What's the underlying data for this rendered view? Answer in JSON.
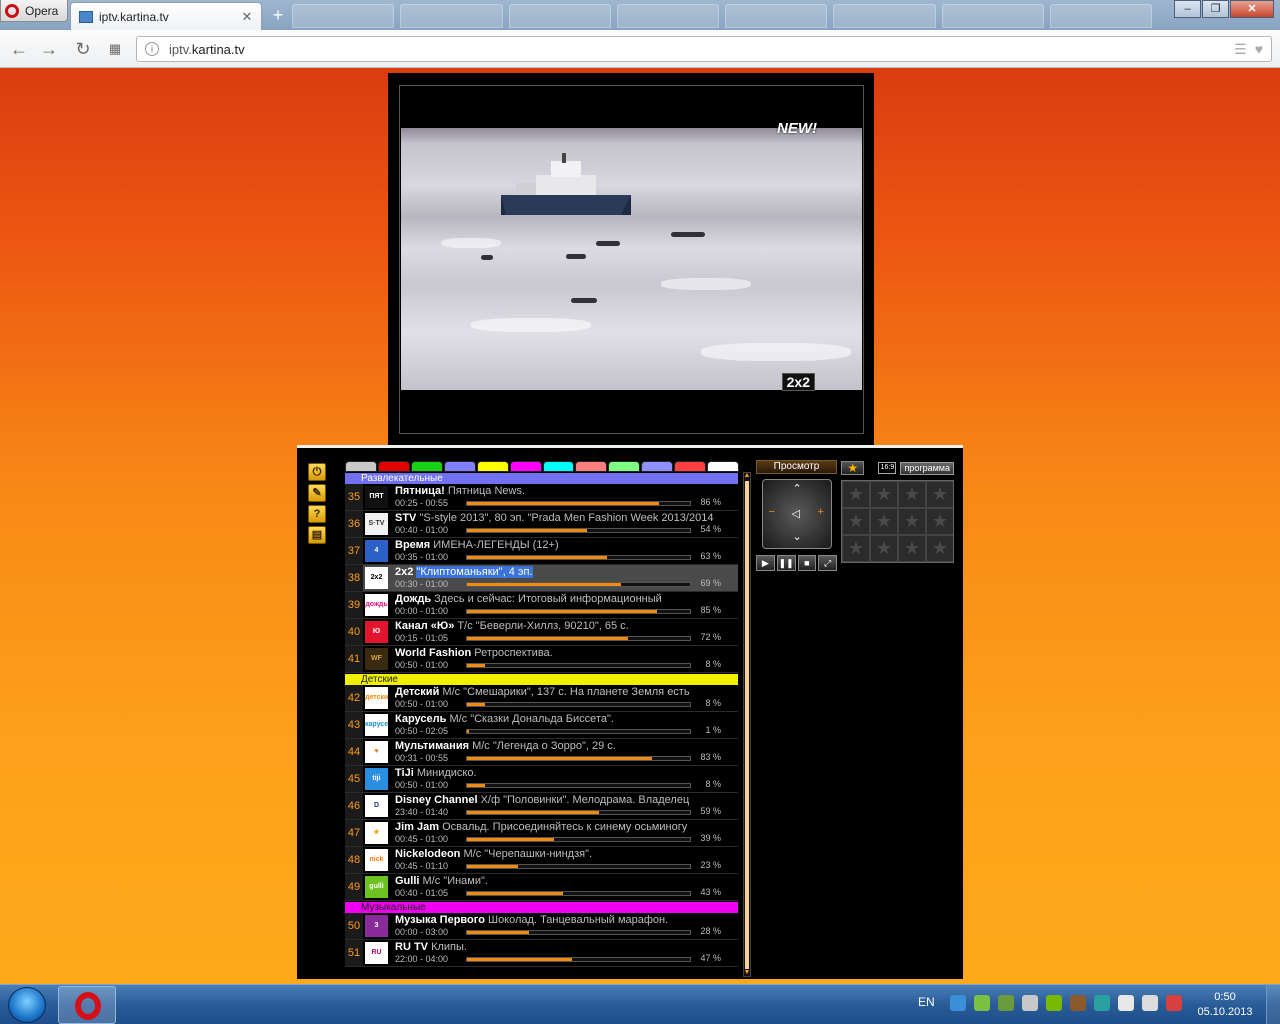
{
  "browser": {
    "menu_label": "Opera",
    "tab_title": "iptv.kartina.tv",
    "url": "iptv.kartina.tv",
    "url_host": "kartina.tv",
    "url_prefix": "iptv."
  },
  "player": {
    "badge_new": "NEW!",
    "channel_logo": "2x2"
  },
  "groups": [
    "#c9c9c9",
    "#e10000",
    "#19d116",
    "#8080ff",
    "#ffff00",
    "#ff00ff",
    "#00ffff",
    "#ff7f7f",
    "#7fff7f",
    "#8f8fff",
    "#ff4040",
    "#ffffff"
  ],
  "channels": {
    "cat1": "Развлекательные",
    "cat2": "Детские",
    "cat3": "Музыкальные",
    "rows": [
      {
        "num": "35",
        "name": "Пятница!",
        "prog": "Пятница News.",
        "time": "00:25 - 00:55",
        "pct": "86 %",
        "fill": 0.86,
        "logo": "ПЯТ",
        "logo_bg": "#111111",
        "logo_fg": "#ffffff"
      },
      {
        "num": "36",
        "name": "STV",
        "prog": "\"S-style 2013\", 80 эп. \"Prada Men Fashion Week 2013/2014",
        "time": "00:40 - 01:00",
        "pct": "54 %",
        "fill": 0.54,
        "logo": "S·TV",
        "logo_bg": "#f2f2f2",
        "logo_fg": "#333333"
      },
      {
        "num": "37",
        "name": "Время",
        "prog": "ИМЕНА-ЛЕГЕНДЫ (12+)",
        "time": "00:35 - 01:00",
        "pct": "63 %",
        "fill": 0.63,
        "logo": "4",
        "logo_bg": "#2b60c7",
        "logo_fg": "#ffffff"
      },
      {
        "num": "38",
        "name": "2x2",
        "prog": "\"Клиптоманьяки\", 4 эп.",
        "time": "00:30 - 01:00",
        "pct": "69 %",
        "fill": 0.69,
        "logo": "2x2",
        "logo_bg": "#ffffff",
        "logo_fg": "#000000"
      },
      {
        "num": "39",
        "name": "Дождь",
        "prog": "Здесь и сейчас: Итоговый информационный",
        "time": "00:00 - 01:00",
        "pct": "85 %",
        "fill": 0.85,
        "logo": "дождь",
        "logo_bg": "#ffffff",
        "logo_fg": "#e5127d"
      },
      {
        "num": "40",
        "name": "Канал «Ю»",
        "prog": "Т/с \"Беверли-Хиллз, 90210\", 65 с.",
        "time": "00:15 - 01:05",
        "pct": "72 %",
        "fill": 0.72,
        "logo": "Ю",
        "logo_bg": "#e3142f",
        "logo_fg": "#ffffff"
      },
      {
        "num": "41",
        "name": "World Fashion",
        "prog": "Ретроспектива.",
        "time": "00:50 - 01:00",
        "pct": "8 %",
        "fill": 0.08,
        "logo": "WF",
        "logo_bg": "#3a2a10",
        "logo_fg": "#d4a64a"
      },
      {
        "num": "42",
        "name": "Детский",
        "prog": "М/с \"Смешарики\", 137 с. На планете Земля есть",
        "time": "00:50 - 01:00",
        "pct": "8 %",
        "fill": 0.08,
        "logo": "детский",
        "logo_bg": "#ffffff",
        "logo_fg": "#f08a00"
      },
      {
        "num": "43",
        "name": "Карусель",
        "prog": "М/с \"Сказки Дональда Биссета\".",
        "time": "00:50 - 02:05",
        "pct": "1 %",
        "fill": 0.01,
        "logo": "карусель",
        "logo_bg": "#ffffff",
        "logo_fg": "#1b8fd8"
      },
      {
        "num": "44",
        "name": "Мультимания",
        "prog": "М/с \"Легенда о Зорро\", 29 с.",
        "time": "00:31 - 00:55",
        "pct": "83 %",
        "fill": 0.83,
        "logo": "♥",
        "logo_bg": "#ffffff",
        "logo_fg": "#f07010"
      },
      {
        "num": "45",
        "name": "TiJi",
        "prog": "Минидиско.",
        "time": "00:50 - 01:00",
        "pct": "8 %",
        "fill": 0.08,
        "logo": "tiji",
        "logo_bg": "#2a8ee0",
        "logo_fg": "#ffffff"
      },
      {
        "num": "46",
        "name": "Disney Channel",
        "prog": "Х/ф \"Половинки\". Мелодрама. Владелец",
        "time": "23:40 - 01:40",
        "pct": "59 %",
        "fill": 0.59,
        "logo": "D",
        "logo_bg": "#ffffff",
        "logo_fg": "#1d3a8a"
      },
      {
        "num": "47",
        "name": "Jim Jam",
        "prog": "Освальд. Присоединяйтесь к синему осьминогу",
        "time": "00:45 - 01:00",
        "pct": "39 %",
        "fill": 0.39,
        "logo": "★",
        "logo_bg": "#ffffff",
        "logo_fg": "#f5a300"
      },
      {
        "num": "48",
        "name": "Nickelodeon",
        "prog": "М/с \"Черепашки-ниндзя\".",
        "time": "00:45 - 01:10",
        "pct": "23 %",
        "fill": 0.23,
        "logo": "nick",
        "logo_bg": "#ffffff",
        "logo_fg": "#f07a10"
      },
      {
        "num": "49",
        "name": "Gulli",
        "prog": "М/с \"Инами\".",
        "time": "00:40 - 01:05",
        "pct": "43 %",
        "fill": 0.43,
        "logo": "gulli",
        "logo_bg": "#6cc21e",
        "logo_fg": "#ffffff"
      },
      {
        "num": "50",
        "name": "Музыка Первого",
        "prog": "Шоколад. Танцевальный марафон.",
        "time": "00:00 - 03:00",
        "pct": "28 %",
        "fill": 0.28,
        "logo": "3",
        "logo_bg": "#8a2a9a",
        "logo_fg": "#ffffff"
      },
      {
        "num": "51",
        "name": "RU TV",
        "prog": "Клипы.",
        "time": "22:00 - 04:00",
        "pct": "47 %",
        "fill": 0.47,
        "logo": "RU",
        "logo_bg": "#ffffff",
        "logo_fg": "#b01070"
      }
    ]
  },
  "controls": {
    "view_label": "Просмотр",
    "program_label": "программа",
    "ratio_label": "16:9"
  },
  "taskbar": {
    "lang": "EN",
    "time": "0:50",
    "date": "05.10.2013"
  }
}
